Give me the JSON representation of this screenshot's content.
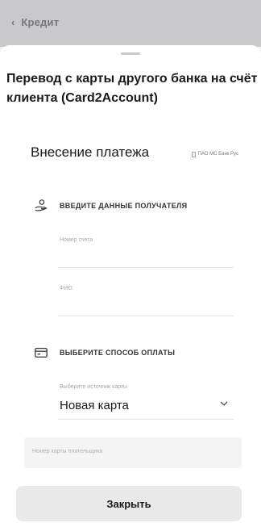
{
  "header": {
    "back_icon": "chevron-left-icon",
    "title": "Кредит"
  },
  "sheet": {
    "title": "Перевод с карты другого банка на счёт клиента (Card2Account)",
    "section_heading": "Внесение платежа",
    "logo_alt": "ПАО МС Банк Рус"
  },
  "recipient": {
    "icon": "hand-coins-icon",
    "label": "ВВЕДИТЕ ДАННЫЕ ПОЛУЧАТЕЛЯ",
    "account_placeholder": "Номер счета",
    "name_placeholder": "ФИО"
  },
  "payment": {
    "icon": "card-icon",
    "label": "ВЫБЕРИТЕ СПОСОБ ОПЛАТЫ",
    "source_caption": "Выберите источник карты",
    "source_value": "Новая карта",
    "payer_placeholder": "Номер карты плательщика"
  },
  "footer": {
    "close_label": "Закрыть"
  }
}
